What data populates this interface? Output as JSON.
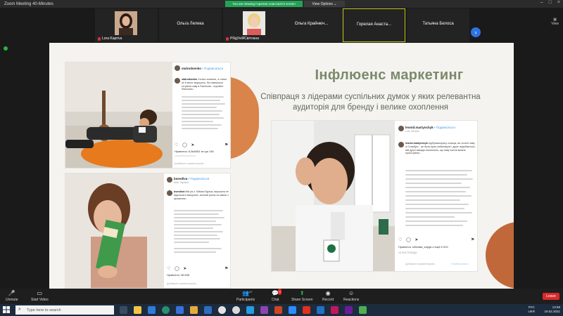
{
  "window": {
    "title": "Zoom Meeting 40-Minutes"
  },
  "banner": {
    "viewing": "You are viewing Горелая Анастасія's screen",
    "view_options": "View Options"
  },
  "participants": [
    {
      "name": "Lora Kapriva",
      "kind": "photo"
    },
    {
      "name": "Ольга Лелека",
      "kind": "name"
    },
    {
      "name": "РЯдУніЯСвітлана",
      "kind": "photo"
    },
    {
      "name": "Ольга  Крайнюч...",
      "kind": "name"
    },
    {
      "name": "Горелая  Анаста...",
      "kind": "name",
      "active": true
    },
    {
      "name": "Татьяна Белоса",
      "kind": "name"
    }
  ],
  "view_label": "View",
  "slide": {
    "title": "Інфлюенс маркетинг",
    "subtitle": "Співпраця з лідерами суспільних думок у яких релевантна аудиторія для бренду і велике охоплення",
    "posts": {
      "post1": {
        "username": "stalrodsenko",
        "follow": "• Подписаться",
        "likes": "Нравится: 6,5к4854 та ще 146",
        "caption_user": "stalrodsenko",
        "caption": "Хочеш зламати, а тільки не в мене змушують. Ви навчилися готувати каву в Starbucks - шукайте Starbucks..."
      },
      "post2": {
        "username": "bsevdiva",
        "follow": "• Подписаться",
        "location": "Київ, Україна",
        "likes": "Нравится: 36 835",
        "caption_user": "bsevdiva",
        "caption": "Мій рік з Тоймас Вурша, вирішила не відстачати вишукано, кожний ранок за кавою з ароматом..."
      },
      "post3": {
        "username": "leonid.martynchyk",
        "follow": "• Подписаться",
        "location": "Lviv, Ukraine",
        "likes": "Нравится: shliciata_sdyga и ещё 6 519",
        "caption_user": "leonid.martynchyk",
        "caption": "#рубрикагарячу копицы, ви хочете каву зі Старбукс - це була щось неймовірне і дуже подобаються, мій друзі завжди пояснюють, що каву інколи можна приготувати..."
      },
      "date3": "16 ЛИСТОПАДА",
      "comment_placeholder": "Добавьте комментарий...",
      "publish": "Опубликовать"
    }
  },
  "toolbar": {
    "unmute": "Unmute",
    "start_video": "Start Video",
    "participants": "Participants",
    "participants_count": "47",
    "chat": "Chat",
    "chat_badge": "3",
    "share": "Share Screen",
    "record": "Record",
    "reactions": "Reactions",
    "leave": "Leave"
  },
  "taskbar": {
    "search_placeholder": "Type here to search",
    "lang": "РУС",
    "lang2": "UKR",
    "time": "13:59",
    "date": "19.02.2021"
  },
  "colors": {
    "accent_green": "#23a255",
    "orange": "#d8844a",
    "title_green": "#7a8a6c",
    "leave_red": "#d92a2a"
  }
}
